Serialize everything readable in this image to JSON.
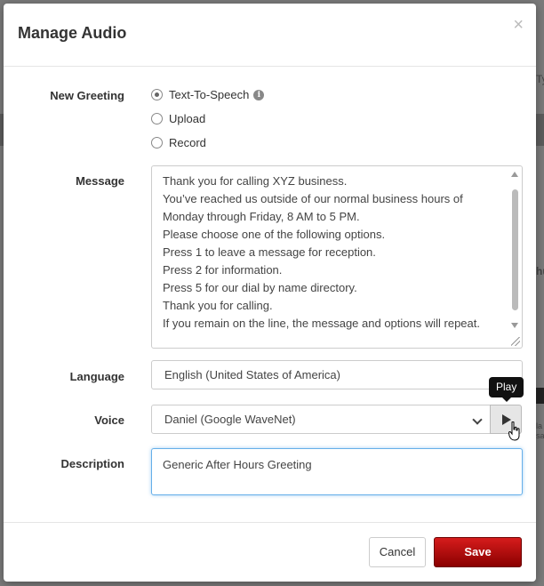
{
  "background": {
    "text_ty": "Ty",
    "text_hu": "hu",
    "text_la": "la",
    "text_sa": "sa"
  },
  "modal": {
    "title": "Manage Audio",
    "close_label": "×",
    "new_greeting": {
      "label": "New Greeting",
      "options": [
        {
          "label": "Text-To-Speech",
          "checked": true
        },
        {
          "label": "Upload",
          "checked": false
        },
        {
          "label": "Record",
          "checked": false
        }
      ]
    },
    "message": {
      "label": "Message",
      "lines": [
        "Thank you for calling XYZ business.",
        "You’ve reached us outside of our normal business hours of",
        "Monday through Friday, 8 AM to 5 PM.",
        "Please choose one of the following options.",
        "Press 1 to leave a message for reception.",
        "Press 2 for information.",
        "Press 5 for our dial by name directory.",
        "Thank you for calling.",
        "If you remain on the line, the message and options will repeat."
      ]
    },
    "language": {
      "label": "Language",
      "value": "English (United States of America)"
    },
    "voice": {
      "label": "Voice",
      "value": "Daniel (Google WaveNet)",
      "play_tooltip": "Play"
    },
    "description": {
      "label": "Description",
      "value": "Generic After Hours Greeting"
    },
    "footer": {
      "cancel_label": "Cancel",
      "save_label": "Save"
    }
  }
}
